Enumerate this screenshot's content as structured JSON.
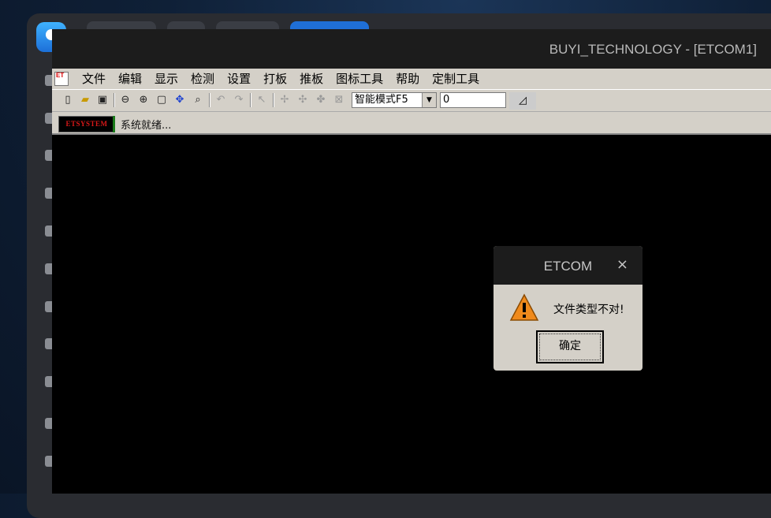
{
  "window": {
    "title": "BUYI_TECHNOLOGY - [ETCOM1]"
  },
  "app_logo": "ET",
  "menu": [
    "文件",
    "编辑",
    "显示",
    "检测",
    "设置",
    "打板",
    "推板",
    "图标工具",
    "帮助",
    "定制工具"
  ],
  "toolbar": {
    "icons": [
      "new-file-icon",
      "open-folder-icon",
      "save-icon",
      "zoom-out-icon",
      "zoom-in-icon",
      "fit-window-icon",
      "move-icon",
      "zoom-area-icon",
      "undo-icon",
      "redo-icon",
      "select-icon",
      "grade-point-icon",
      "grade-point-2-icon",
      "grade-point-3-icon",
      "grade-point-4-icon"
    ],
    "mode_select": "智能模式F5",
    "value_input": "0"
  },
  "status": {
    "brand": "ETSYSTEM",
    "text": "系统就绪..."
  },
  "dialog": {
    "title": "ETCOM",
    "close": "×",
    "message": "文件类型不对!",
    "ok_label": "确定"
  },
  "colors": {
    "menu_bg": "#d4d0c8",
    "canvas_bg": "#000000",
    "brand_red": "#d81818"
  }
}
